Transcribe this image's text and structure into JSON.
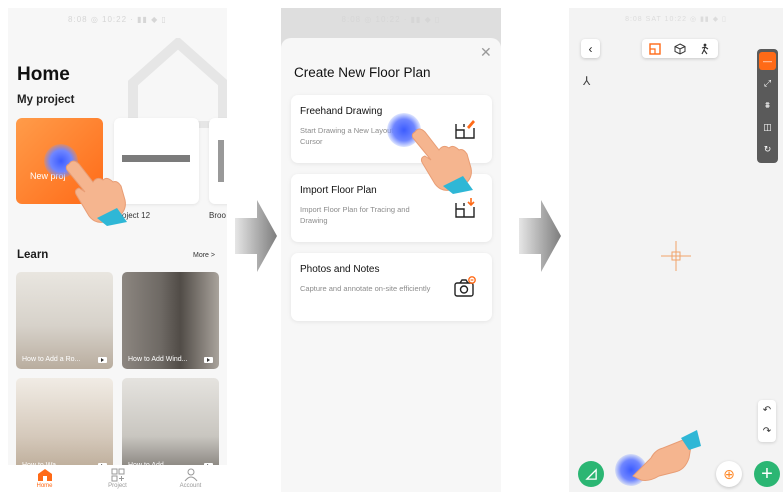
{
  "screen1": {
    "status_text": "8:08 ◎ 10:22 ·  ▮▮ ◆ ▯",
    "title": "Home",
    "section_projects": "My project",
    "new_project_label": "New proj",
    "projects": [
      "Project 12",
      "Broo"
    ],
    "section_learn": "Learn",
    "more_label": "More >",
    "videos": [
      "How to Add a Ro...",
      "How to Add Wind...",
      "How to Wa...",
      "How to Add..."
    ],
    "tabs": [
      "Home",
      "Project",
      "Account"
    ]
  },
  "screen2": {
    "status_text": "8:08 ◎ 10:22 ·  ▮▮ ◆ ▯",
    "title": "Create New Floor Plan",
    "options": [
      {
        "heading": "Freehand Drawing",
        "desc": "Start Drawing a New Layout with the Cursor"
      },
      {
        "heading": "Import Floor Plan",
        "desc": "Import Floor Plan for Tracing and Drawing"
      },
      {
        "heading": "Photos and Notes",
        "desc": "Capture and annotate on-site efficiently"
      }
    ]
  },
  "screen3": {
    "status_text": "8:08 SAT  10:22 ◎ ▮▮ ◆ ▯",
    "accent_color": "#ff6a17",
    "green_color": "#2bb673"
  },
  "colors": {
    "accent": "#ff6a17",
    "touch": "#3c5cff"
  }
}
